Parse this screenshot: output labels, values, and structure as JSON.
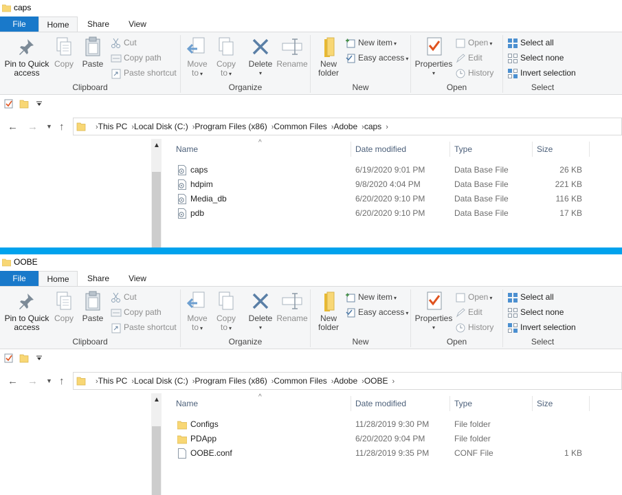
{
  "windows": [
    {
      "title": "caps",
      "tabs": {
        "file": "File",
        "home": "Home",
        "share": "Share",
        "view": "View"
      },
      "ribbon": {
        "clipboard": {
          "label": "Clipboard",
          "pin": "Pin to Quick access",
          "copy": "Copy",
          "paste": "Paste",
          "cut": "Cut",
          "copy_path": "Copy path",
          "paste_shortcut": "Paste shortcut"
        },
        "organize": {
          "label": "Organize",
          "move_to": "Move to",
          "copy_to": "Copy to",
          "delete": "Delete",
          "rename": "Rename"
        },
        "new": {
          "label": "New",
          "new_folder": "New folder",
          "new_item": "New item",
          "easy_access": "Easy access"
        },
        "open": {
          "label": "Open",
          "properties": "Properties",
          "open": "Open",
          "edit": "Edit",
          "history": "History"
        },
        "select": {
          "label": "Select",
          "select_all": "Select all",
          "select_none": "Select none",
          "invert": "Invert selection"
        }
      },
      "breadcrumb": [
        "This PC",
        "Local Disk (C:)",
        "Program Files (x86)",
        "Common Files",
        "Adobe",
        "caps"
      ],
      "columns": {
        "name": "Name",
        "date": "Date modified",
        "type": "Type",
        "size": "Size"
      },
      "files": [
        {
          "name": "caps",
          "date": "6/19/2020 9:01 PM",
          "type": "Data Base File",
          "size": "26 KB",
          "icon": "database-file-icon"
        },
        {
          "name": "hdpim",
          "date": "9/8/2020 4:04 PM",
          "type": "Data Base File",
          "size": "221 KB",
          "icon": "database-file-icon"
        },
        {
          "name": "Media_db",
          "date": "6/20/2020 9:10 PM",
          "type": "Data Base File",
          "size": "116 KB",
          "icon": "database-file-icon"
        },
        {
          "name": "pdb",
          "date": "6/20/2020 9:10 PM",
          "type": "Data Base File",
          "size": "17 KB",
          "icon": "database-file-icon"
        }
      ]
    },
    {
      "title": "OOBE",
      "tabs": {
        "file": "File",
        "home": "Home",
        "share": "Share",
        "view": "View"
      },
      "ribbon": {
        "clipboard": {
          "label": "Clipboard",
          "pin": "Pin to Quick access",
          "copy": "Copy",
          "paste": "Paste",
          "cut": "Cut",
          "copy_path": "Copy path",
          "paste_shortcut": "Paste shortcut"
        },
        "organize": {
          "label": "Organize",
          "move_to": "Move to",
          "copy_to": "Copy to",
          "delete": "Delete",
          "rename": "Rename"
        },
        "new": {
          "label": "New",
          "new_folder": "New folder",
          "new_item": "New item",
          "easy_access": "Easy access"
        },
        "open": {
          "label": "Open",
          "properties": "Properties",
          "open": "Open",
          "edit": "Edit",
          "history": "History"
        },
        "select": {
          "label": "Select",
          "select_all": "Select all",
          "select_none": "Select none",
          "invert": "Invert selection"
        }
      },
      "breadcrumb": [
        "This PC",
        "Local Disk (C:)",
        "Program Files (x86)",
        "Common Files",
        "Adobe",
        "OOBE"
      ],
      "columns": {
        "name": "Name",
        "date": "Date modified",
        "type": "Type",
        "size": "Size"
      },
      "files": [
        {
          "name": "Configs",
          "date": "11/28/2019 9:30 PM",
          "type": "File folder",
          "size": "",
          "icon": "folder-icon"
        },
        {
          "name": "PDApp",
          "date": "6/20/2020 9:04 PM",
          "type": "File folder",
          "size": "",
          "icon": "folder-icon"
        },
        {
          "name": "OOBE.conf",
          "date": "11/28/2019 9:35 PM",
          "type": "CONF File",
          "size": "1 KB",
          "icon": "file-icon"
        }
      ]
    }
  ],
  "colors": {
    "accent": "#1979ca",
    "divider": "#00a2ed",
    "ribbon_bg": "#f5f6f7",
    "folder": "#f8d775"
  }
}
